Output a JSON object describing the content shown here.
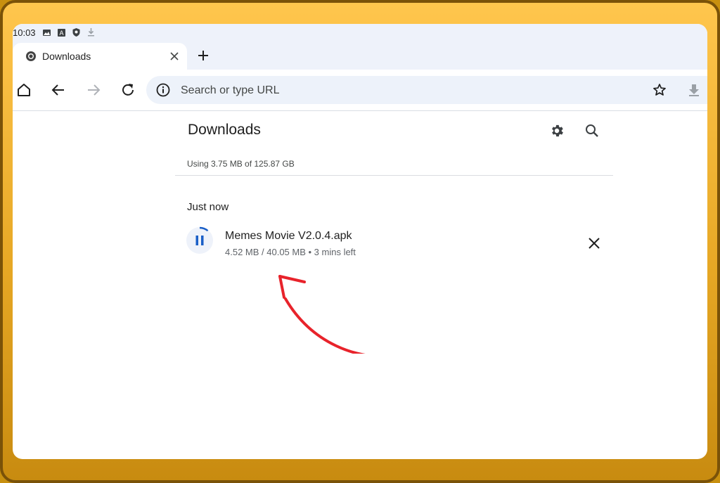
{
  "status_bar": {
    "time": "10:03"
  },
  "tab": {
    "title": "Downloads"
  },
  "omnibox": {
    "placeholder": "Search or type URL"
  },
  "page": {
    "title": "Downloads",
    "storage_text": "Using 3.75 MB of 125.87 GB",
    "section_label": "Just now"
  },
  "download_item": {
    "file_name": "Memes Movie V2.0.4.apk",
    "progress_text": "4.52 MB / 40.05 MB • 3 mins left",
    "progress_fraction": 0.113
  },
  "icons": {
    "status": [
      "image-icon",
      "accessibility-icon",
      "shield-icon",
      "download-status-icon"
    ],
    "toolbar": [
      "home-icon",
      "back-icon",
      "forward-icon",
      "reload-icon",
      "info-icon",
      "star-icon",
      "download-icon"
    ],
    "page": [
      "settings-gear-icon",
      "search-icon",
      "pause-icon",
      "close-icon"
    ]
  },
  "colors": {
    "accent": "#1a5fc7",
    "annotation_arrow": "#e8232b",
    "frame": "#f3b73a"
  }
}
